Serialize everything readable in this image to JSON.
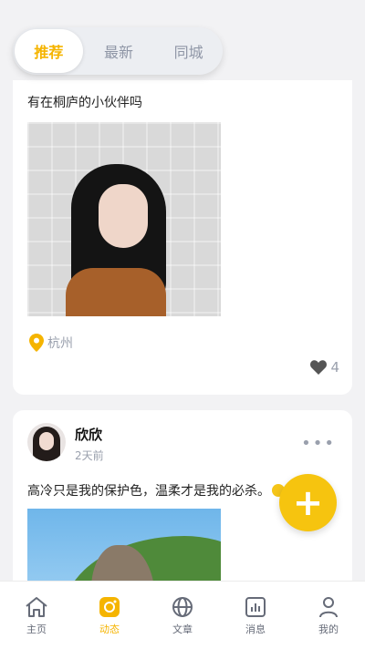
{
  "tabs": [
    {
      "label": "推荐",
      "active": true
    },
    {
      "label": "最新",
      "active": false
    },
    {
      "label": "同城",
      "active": false
    }
  ],
  "post1": {
    "text": "有在桐庐的小伙伴吗",
    "location": "杭州",
    "likes": "4",
    "icons": {
      "location": "location-pin-icon",
      "like": "heart-icon"
    }
  },
  "post2": {
    "username": "欣欣",
    "time": "2天前",
    "text": "高冷只是我的保护色，温柔才是我的必杀。",
    "more_icon": "more-dots-icon"
  },
  "fab": {
    "label": "+",
    "color": "#f6c40f"
  },
  "bottom_nav": [
    {
      "label": "主页",
      "icon": "home-icon",
      "active": false
    },
    {
      "label": "动态",
      "icon": "moments-icon",
      "active": true
    },
    {
      "label": "文章",
      "icon": "globe-icon",
      "active": false
    },
    {
      "label": "消息",
      "icon": "chart-icon",
      "active": false
    },
    {
      "label": "我的",
      "icon": "user-icon",
      "active": false
    }
  ],
  "colors": {
    "accent": "#f5b400",
    "muted": "#9aa0ad"
  }
}
